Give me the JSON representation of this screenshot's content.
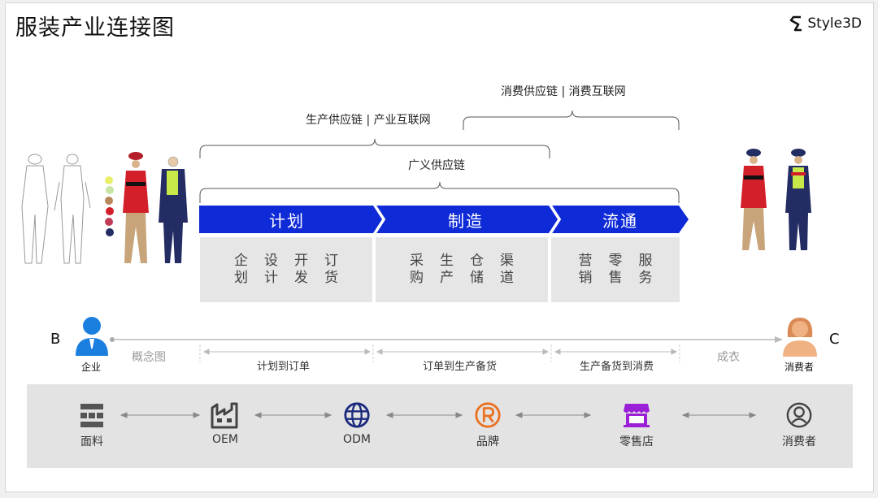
{
  "title": "服装产业连接图",
  "logo": {
    "text": "Style3D",
    "icon": "style3d-logo-icon"
  },
  "brackets": {
    "consumer": "消费供应链 | 消费互联网",
    "production": "生产供应链 | 产业互联网",
    "broad": "广义供应链"
  },
  "stages": [
    {
      "label": "计划",
      "items": [
        [
          "企",
          "设",
          "开",
          "订"
        ],
        [
          "划",
          "计",
          "发",
          "货"
        ]
      ]
    },
    {
      "label": "制造",
      "items": [
        [
          "采",
          "生",
          "仓",
          "渠"
        ],
        [
          "购",
          "产",
          "储",
          "道"
        ]
      ]
    },
    {
      "label": "流通",
      "items": [
        [
          "营",
          "零",
          "服"
        ],
        [
          "销",
          "售",
          "务"
        ]
      ]
    }
  ],
  "timeline": {
    "left_mark": "B",
    "right_mark": "C",
    "left_person": "企业",
    "right_person": "消费者",
    "segments": [
      "概念图",
      "计划到订单",
      "订单到生产备货",
      "生产备货到消费",
      "成衣"
    ]
  },
  "nodes": [
    {
      "label": "面料",
      "icon": "fabric-icon"
    },
    {
      "label": "OEM",
      "icon": "factory-icon"
    },
    {
      "label": "ODM",
      "icon": "globe-icon"
    },
    {
      "label": "品牌",
      "icon": "registered-brand-icon"
    },
    {
      "label": "零售店",
      "icon": "store-icon"
    },
    {
      "label": "消费者",
      "icon": "consumer-icon"
    }
  ],
  "colors": {
    "stage_blue": "#0f2bd8",
    "person_blue": "#1b7fe0",
    "person_peach": "#f1b283",
    "store_purple": "#9b1fd6",
    "brand_orange": "#ea7222",
    "globe_navy": "#1b2a7d"
  },
  "swatches": [
    "#e8f06a",
    "#c9e3a2",
    "#b8875a",
    "#d21f2a",
    "#c03b55",
    "#232c63"
  ]
}
